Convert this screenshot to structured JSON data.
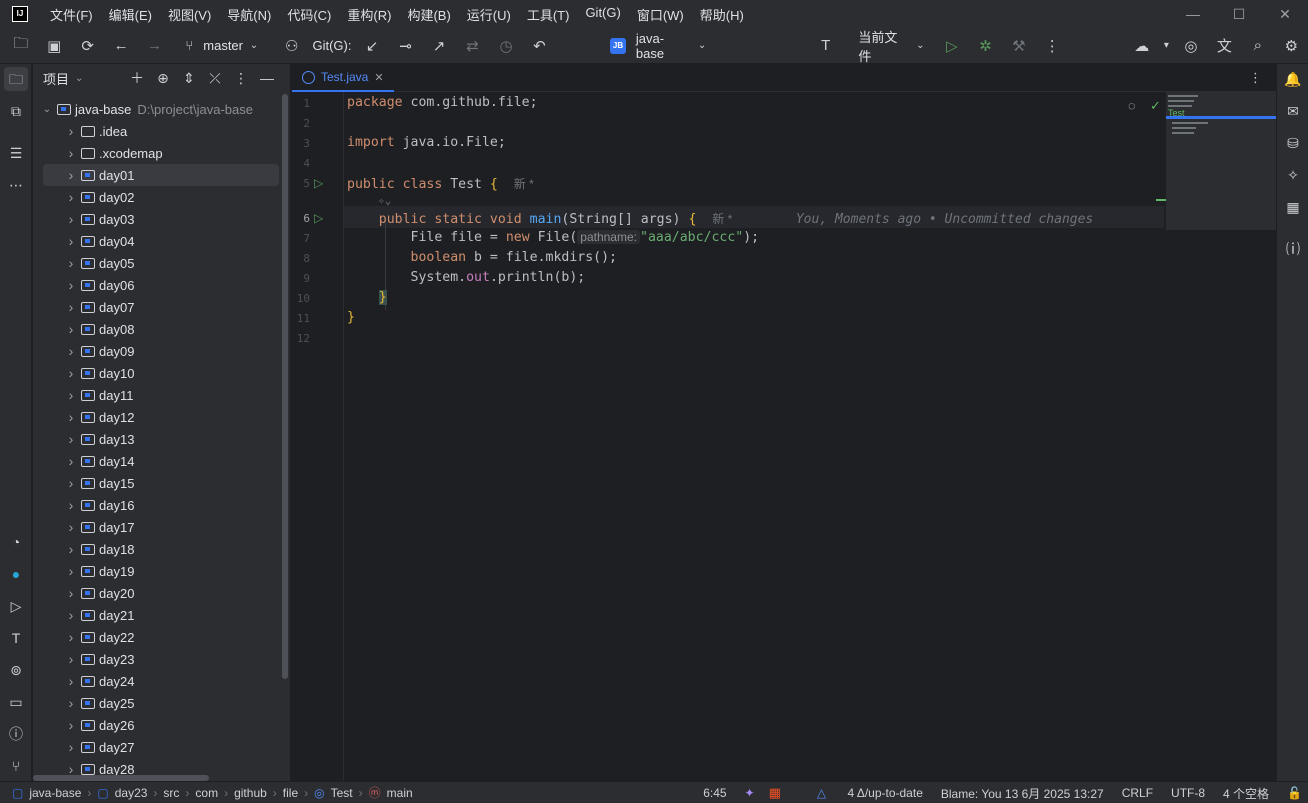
{
  "titlebar": {
    "menu": [
      "文件(F)",
      "编辑(E)",
      "视图(V)",
      "导航(N)",
      "代码(C)",
      "重构(R)",
      "构建(B)",
      "运行(U)",
      "工具(T)",
      "Git(G)",
      "窗口(W)",
      "帮助(H)"
    ],
    "logo": "IJ"
  },
  "toolbar": {
    "branch": "master",
    "git_label": "Git(G):",
    "project_badge": "JB",
    "project_name": "java-base",
    "run_config": "当前文件"
  },
  "project_panel": {
    "title": "项目",
    "root": {
      "name": "java-base",
      "path": "D:\\project\\java-base"
    },
    "items": [
      ".idea",
      ".xcodemap",
      "day01",
      "day02",
      "day03",
      "day04",
      "day05",
      "day06",
      "day07",
      "day08",
      "day09",
      "day10",
      "day11",
      "day12",
      "day13",
      "day14",
      "day15",
      "day16",
      "day17",
      "day18",
      "day19",
      "day20",
      "day21",
      "day22",
      "day23",
      "day24",
      "day25",
      "day26",
      "day27",
      "day28"
    ],
    "selected": "day01"
  },
  "editor": {
    "tab_name": "Test.java",
    "lines": [
      "1",
      "2",
      "3",
      "4",
      "5",
      "6",
      "7",
      "8",
      "9",
      "10",
      "11",
      "12"
    ],
    "current_line": "6",
    "code": {
      "l1_kw": "package",
      "l1_rest": " com.github.file;",
      "l3_kw": "import",
      "l3_rest": " java.io.File;",
      "l5_kw": "public class",
      "l5_name": " Test ",
      "l5_brace": "{",
      "new_hint": "新 *",
      "l6_kw": "public static void",
      "l6_fn": "main",
      "l6_rest": "(String[] args) ",
      "l6_brace": "{",
      "l7_a": "File file = ",
      "l7_kw": "new",
      "l7_b": " File(",
      "l7_param": "pathname:",
      "l7_str": "\"aaa/abc/ccc\"",
      "l7_c": ");",
      "l8_kw": "boolean",
      "l8_rest": " b = file.mkdirs();",
      "l9_a": "System.",
      "l9_fld": "out",
      "l9_b": ".println(b);",
      "close_inner": "}",
      "close_outer": "}"
    },
    "blame": "You, Moments ago • Uncommitted changes",
    "minimap_title": "Test"
  },
  "statusbar": {
    "breadcrumb": [
      "java-base",
      "day23",
      "src",
      "com",
      "github",
      "file",
      "Test",
      "main"
    ],
    "cursor": "6:45",
    "vcs": "4 Δ/up-to-date",
    "blame": "Blame: You 13 6月 2025 13:27",
    "line_sep": "CRLF",
    "encoding": "UTF-8",
    "indent": "4 个空格"
  }
}
